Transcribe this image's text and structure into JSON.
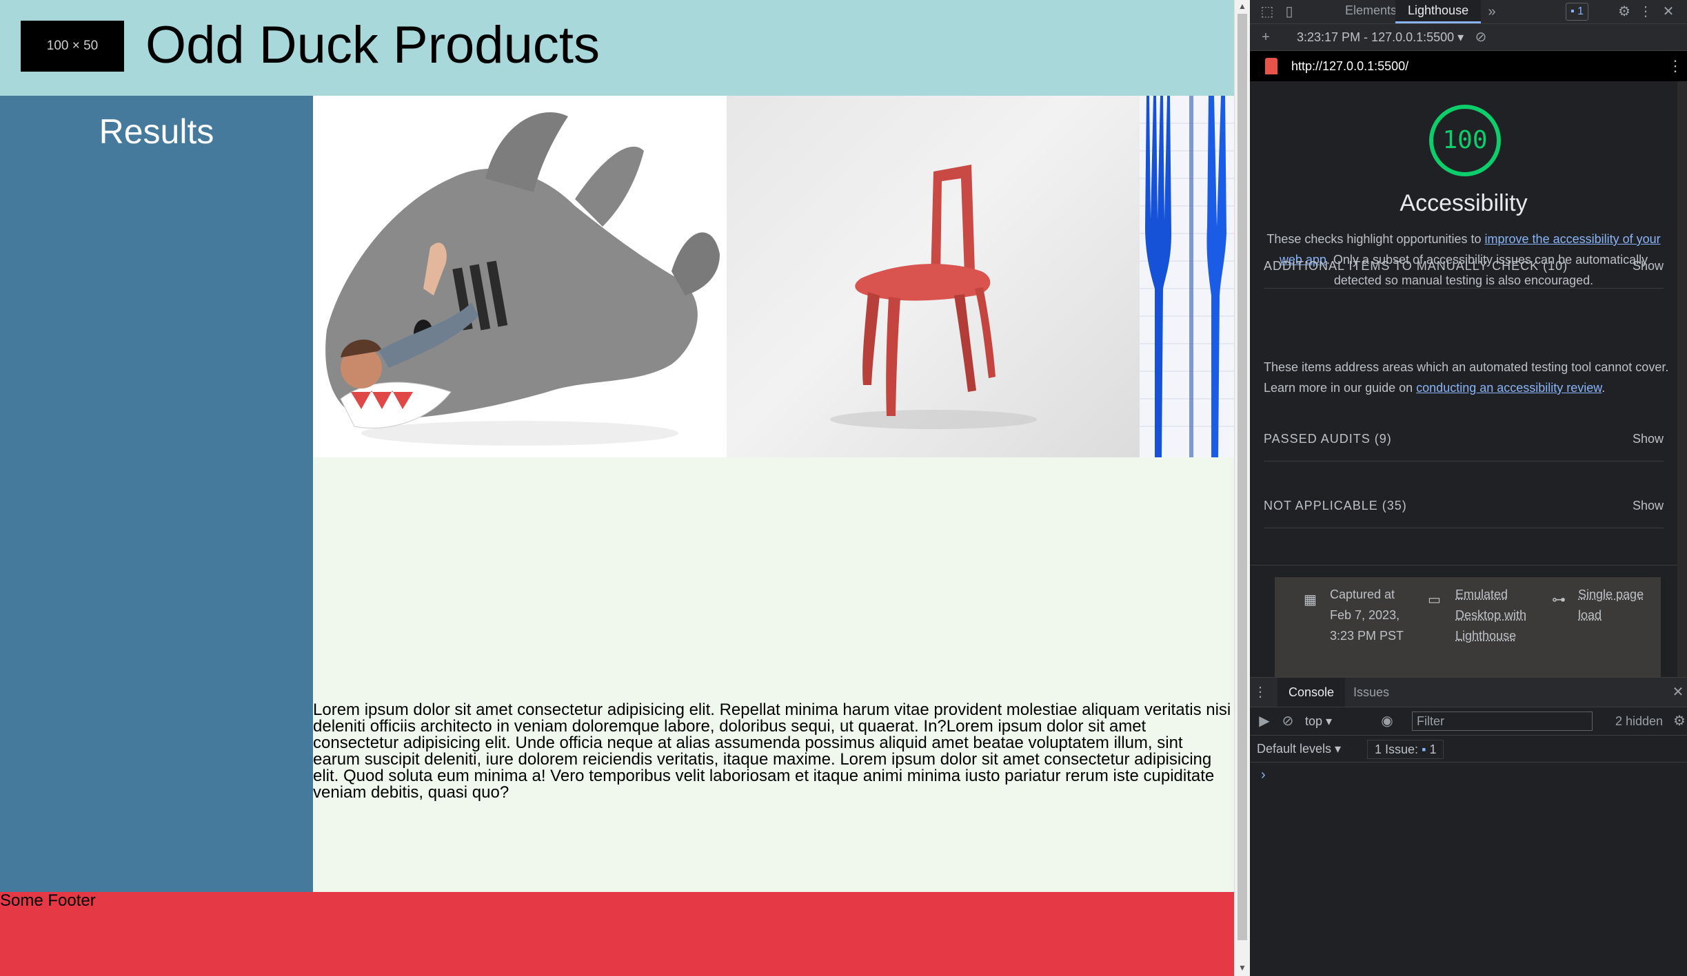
{
  "site": {
    "logo_placeholder": "100 × 50",
    "title": "Odd Duck Products",
    "sidebar_title": "Results",
    "paragraph": "Lorem ipsum dolor sit amet consectetur adipisicing elit. Repellat minima harum vitae provident molestiae aliquam veritatis nisi deleniti officiis architecto in veniam doloremque labore, doloribus sequi, ut quaerat. In?Lorem ipsum dolor sit amet consectetur adipisicing elit. Unde officia neque at alias assumenda possimus aliquid amet beatae voluptatem illum, sint earum suscipit deleniti, iure dolorem reiciendis veritatis, itaque maxime. Lorem ipsum dolor sit amet consectetur adipisicing elit. Quod soluta eum minima a! Vero temporibus velit laboriosam et itaque animi minima iusto pariatur rerum iste cupiditate veniam debitis, quasi quo?",
    "footer": "Some Footer",
    "colors": {
      "header": "#a8d8da",
      "sidebar": "#457a9c",
      "main": "#f0f8ed",
      "footer": "#e63946"
    }
  },
  "devtools": {
    "tabs": [
      "Elements",
      "Lighthouse"
    ],
    "active_tab": "Lighthouse",
    "issues_count": "1",
    "report_select": "3:23:17 PM - 127.0.0.1:5500 ▾",
    "url": "http://127.0.0.1:5500/",
    "score": "100",
    "category_title": "Accessibility",
    "desc_pre": "These checks highlight opportunities to ",
    "desc_link": "improve the accessibility of your web app",
    "desc_post": ". Only a subset of accessibility issues can be automatically detected so manual testing is also encouraged.",
    "groups": [
      {
        "title": "ADDITIONAL ITEMS TO MANUALLY CHECK (10)",
        "action": "Show"
      },
      {
        "title": "PASSED AUDITS (9)",
        "action": "Show"
      },
      {
        "title": "NOT APPLICABLE (35)",
        "action": "Show"
      }
    ],
    "manual_pre": "These items address areas which an automated testing tool cannot cover. Learn more in our guide on ",
    "manual_link": "conducting an accessibility review",
    "manual_post": ".",
    "meta": {
      "captured_label": "Captured at Feb 7, 2023, 3:23 PM PST",
      "device": "Emulated Desktop with Lighthouse",
      "mode": "Single page load"
    },
    "drawer_tabs": [
      "Console",
      "Issues"
    ],
    "context": "top",
    "filter_placeholder": "Filter",
    "hidden": "2 hidden",
    "levels": "Default levels ▾",
    "issue_summary": "1 Issue:",
    "issue_count": "1",
    "prompt": "›"
  }
}
